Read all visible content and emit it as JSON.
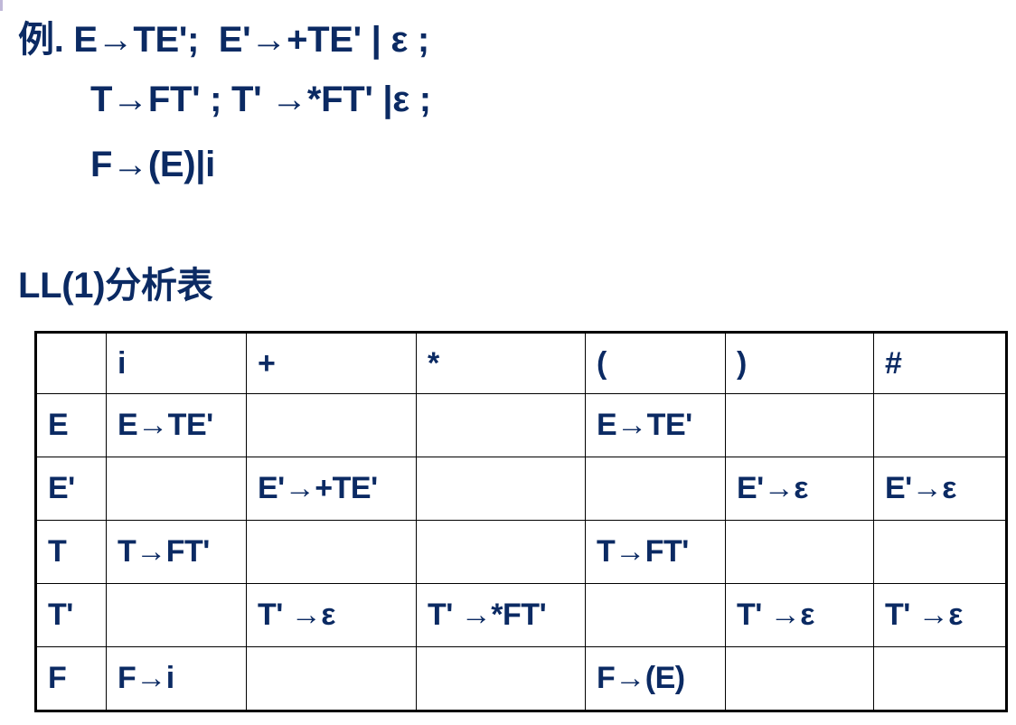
{
  "grammar": {
    "lines": [
      "例. E→TE';  E'→+TE' | ε ;",
      "T→FT' ; T' →*FT' |ε ;",
      "F→(E)|i"
    ]
  },
  "table_title": "LL(1)分析表",
  "table": {
    "header": [
      "",
      "i",
      "+",
      "*",
      "(",
      ")",
      "#"
    ],
    "rows": [
      [
        "E",
        "E→TE'",
        "",
        "",
        "E→TE'",
        "",
        ""
      ],
      [
        "E'",
        "",
        "E'→+TE'",
        "",
        "",
        "E'→ε",
        "E'→ε"
      ],
      [
        "T",
        "T→FT'",
        "",
        "",
        "T→FT'",
        "",
        ""
      ],
      [
        "T'",
        "",
        "T' →ε",
        "T' →*FT'",
        "",
        "T' →ε",
        "T' →ε"
      ],
      [
        "F",
        "F→i",
        "",
        "",
        "F→(E)",
        "",
        ""
      ]
    ]
  }
}
